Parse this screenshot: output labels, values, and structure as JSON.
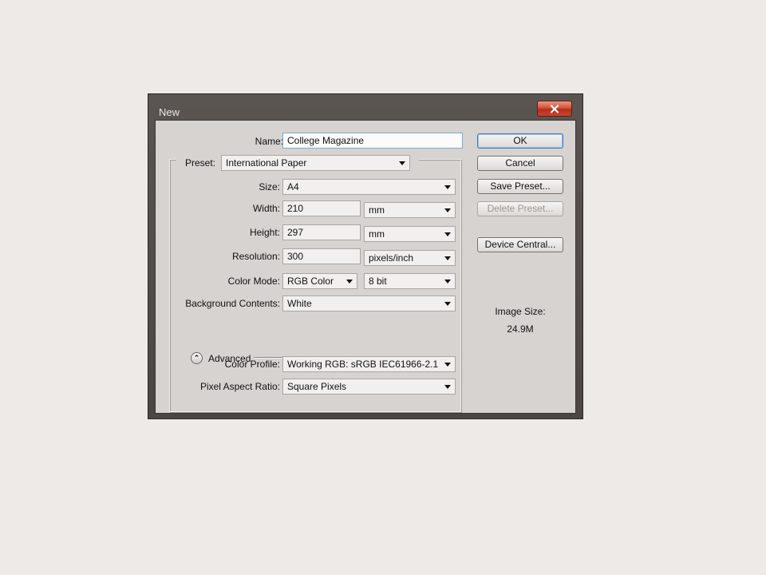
{
  "dialog": {
    "title": "New",
    "name": {
      "label": "Name:",
      "value": "College Magazine"
    },
    "preset": {
      "label": "Preset:",
      "value": "International Paper"
    },
    "size": {
      "label": "Size:",
      "value": "A4"
    },
    "width": {
      "label": "Width:",
      "value": "210",
      "unit": "mm"
    },
    "height": {
      "label": "Height:",
      "value": "297",
      "unit": "mm"
    },
    "resolution": {
      "label": "Resolution:",
      "value": "300",
      "unit": "pixels/inch"
    },
    "color_mode": {
      "label": "Color Mode:",
      "value": "RGB Color",
      "depth": "8 bit"
    },
    "background": {
      "label": "Background Contents:",
      "value": "White"
    },
    "advanced": {
      "label": "Advanced"
    },
    "color_profile": {
      "label": "Color Profile:",
      "value": "Working RGB:  sRGB IEC61966-2.1"
    },
    "pixel_aspect": {
      "label": "Pixel Aspect Ratio:",
      "value": "Square Pixels"
    },
    "buttons": {
      "ok": "OK",
      "cancel": "Cancel",
      "save_preset": "Save Preset...",
      "delete_preset": "Delete Preset...",
      "device_central": "Device Central..."
    },
    "image_size": {
      "label": "Image Size:",
      "value": "24.9M"
    },
    "icons": {
      "close": "close-icon",
      "advanced_toggle": "chevron-up-icon"
    },
    "colors": {
      "default_button_border": "#3d7bbd",
      "close_button": "#c9452d"
    }
  }
}
